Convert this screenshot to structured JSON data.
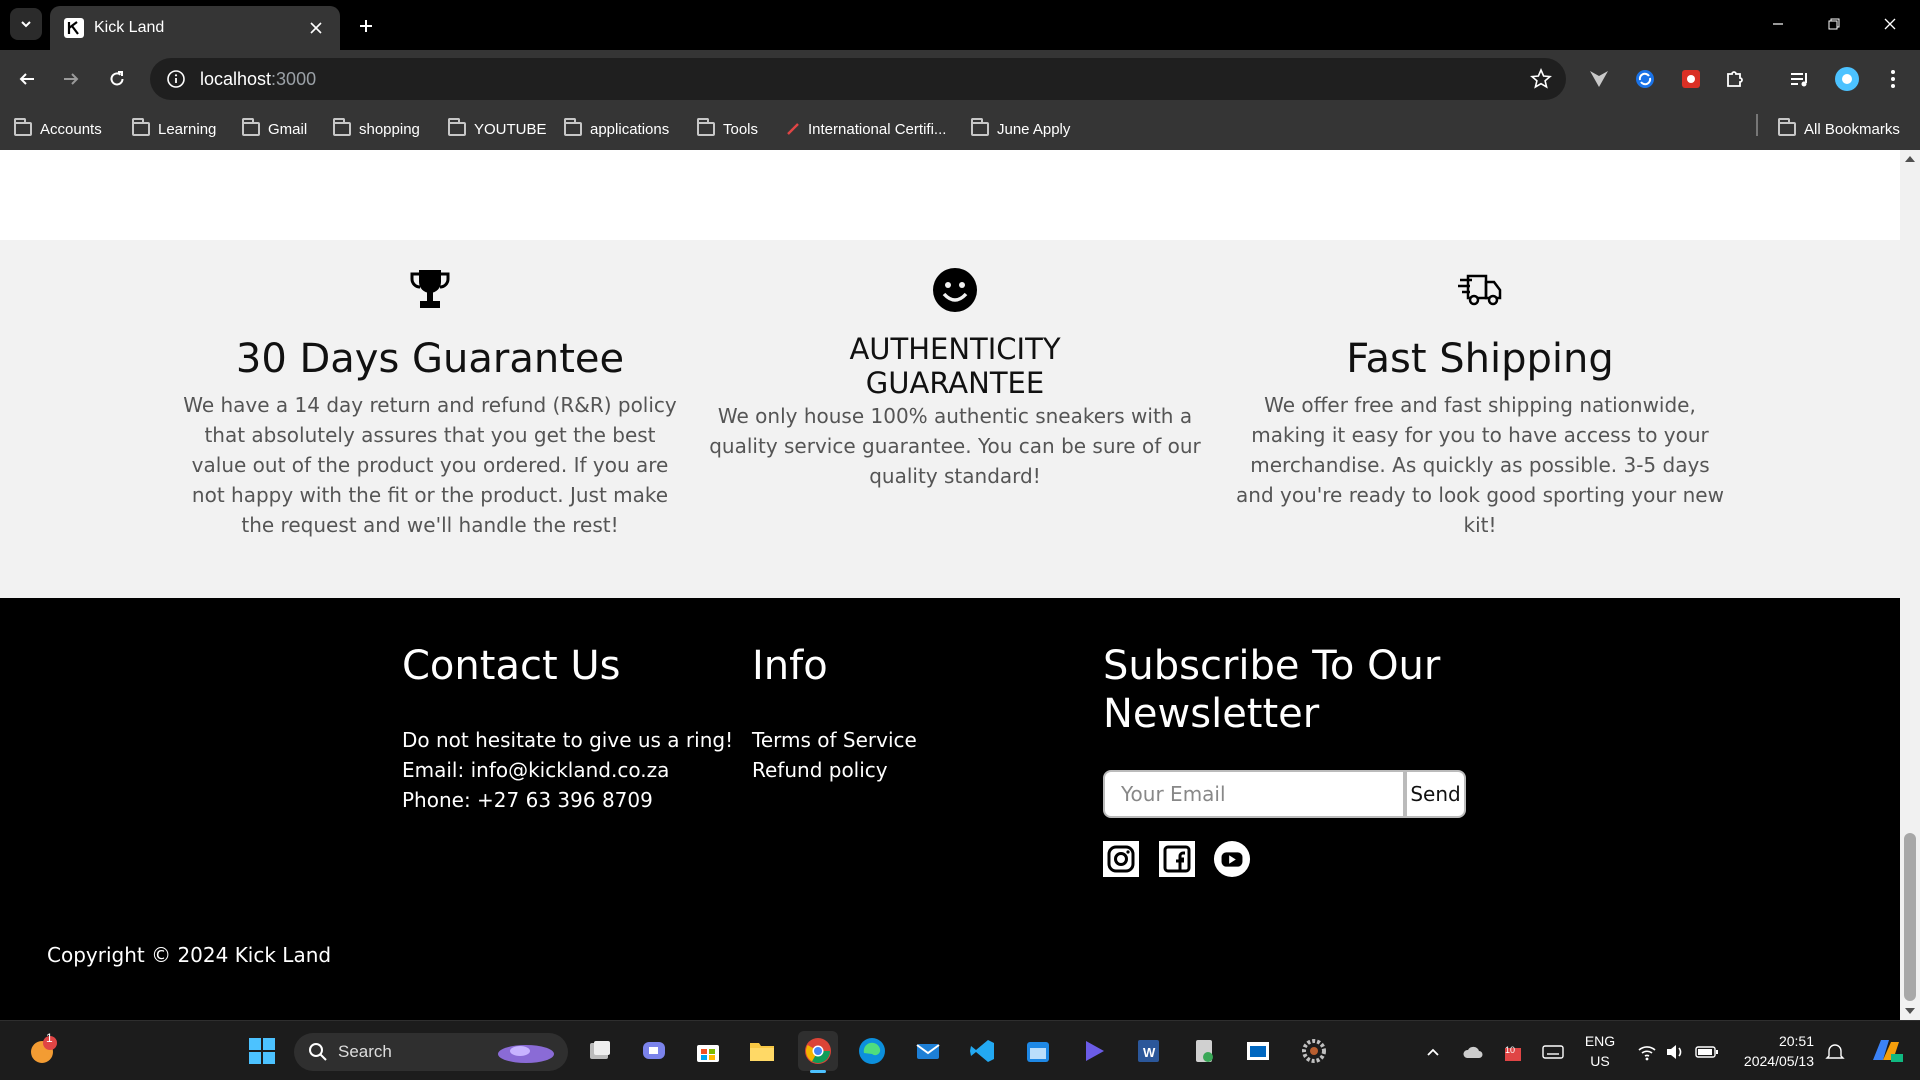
{
  "browser": {
    "tab_title": "Kick Land",
    "url_host": "localhost",
    "url_port": ":3000",
    "bookmarks": [
      {
        "label": "Accounts",
        "icon": "folder-icon"
      },
      {
        "label": "Learning",
        "icon": "folder-icon"
      },
      {
        "label": "Gmail",
        "icon": "folder-icon"
      },
      {
        "label": "shopping",
        "icon": "folder-icon"
      },
      {
        "label": "YOUTUBE",
        "icon": "folder-icon"
      },
      {
        "label": "applications",
        "icon": "folder-icon"
      },
      {
        "label": "Tools",
        "icon": "folder-icon"
      },
      {
        "label": "International Certifi...",
        "icon": "link-icon"
      },
      {
        "label": "June Apply",
        "icon": "folder-icon"
      }
    ],
    "all_bookmarks": "All Bookmarks"
  },
  "features": [
    {
      "icon": "trophy-icon",
      "title": "30 Days Guarantee",
      "text": "We have a 14 day return and refund (R&R) policy that absolutely assures that you get the best value out of the product you ordered. If you are not happy with the fit or the product. Just make the request and we'll handle the rest!"
    },
    {
      "icon": "smiley-icon",
      "title": "AUTHENTICITY GUARANTEE",
      "text": "We only house 100% authentic sneakers with a quality service guarantee. You can be sure of our quality standard!"
    },
    {
      "icon": "delivery-truck-icon",
      "title": "Fast Shipping",
      "text": "We offer free and fast shipping nationwide, making it easy for you to have access to your merchandise. As quickly as possible. 3-5 days and you're ready to look good sporting your new kit!"
    }
  ],
  "footer": {
    "contact": {
      "heading": "Contact Us",
      "line1": "Do not hesitate to give us a ring!",
      "line2": "Email: info@kickland.co.za",
      "line3": "Phone: +27 63 396 8709"
    },
    "info": {
      "heading": "Info",
      "links": [
        "Terms of Service",
        "Refund policy"
      ]
    },
    "newsletter": {
      "heading_line1": "Subscribe To Our",
      "heading_line2": "Newsletter",
      "placeholder": "Your Email",
      "button": "Send"
    },
    "social": [
      "instagram-icon",
      "facebook-icon",
      "youtube-icon"
    ],
    "copyright": "Copyright © 2024 Kick Land"
  },
  "taskbar": {
    "search_placeholder": "Search",
    "notification_count": "1",
    "lang_line1": "ENG",
    "lang_line2": "US",
    "time": "20:51",
    "date": "2024/05/13",
    "battery_badge": "10"
  },
  "colors": {
    "accent": "#4cc2ff",
    "page_bg": "#ffffff",
    "features_bg": "#f2f2f2",
    "footer_bg": "#000000"
  }
}
